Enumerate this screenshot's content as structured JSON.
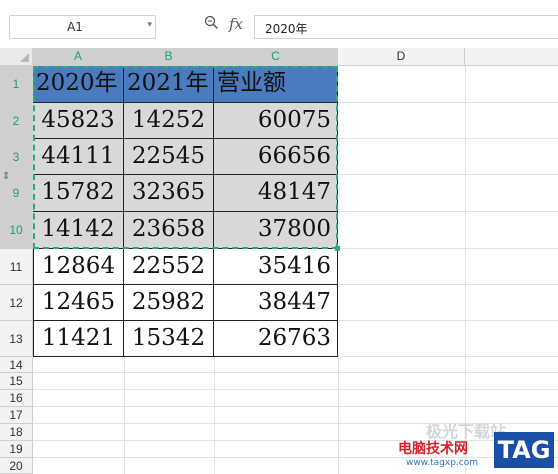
{
  "formula_bar": {
    "name_box": "A1",
    "zoom_icon": "magnifier-icon",
    "fx_label": "fx",
    "formula_value": "2020年"
  },
  "columns": [
    "A",
    "B",
    "C",
    "D"
  ],
  "rows": [
    "1",
    "2",
    "3",
    "9",
    "10",
    "11",
    "12",
    "13",
    "14",
    "15",
    "16",
    "17",
    "18",
    "19",
    "20"
  ],
  "selection": {
    "range": "A1:C10",
    "accent": "#2daa7c"
  },
  "colors": {
    "header_fill": "#4a7bbf",
    "selected_fill": "#d9d9d9"
  },
  "table": {
    "header": [
      "2020年",
      "2021年",
      "营业额"
    ],
    "data": [
      [
        "45823",
        "14252",
        "60075"
      ],
      [
        "44111",
        "22545",
        "66656"
      ],
      [
        "15782",
        "32365",
        "48147"
      ],
      [
        "14142",
        "23658",
        "37800"
      ],
      [
        "12864",
        "22552",
        "35416"
      ],
      [
        "12465",
        "25982",
        "38447"
      ],
      [
        "11421",
        "15342",
        "26763"
      ]
    ]
  },
  "watermark": {
    "line1": "极光下载站",
    "line2": "电脑技术网",
    "line3": "www.tagxp.com",
    "badge": "TAG"
  }
}
